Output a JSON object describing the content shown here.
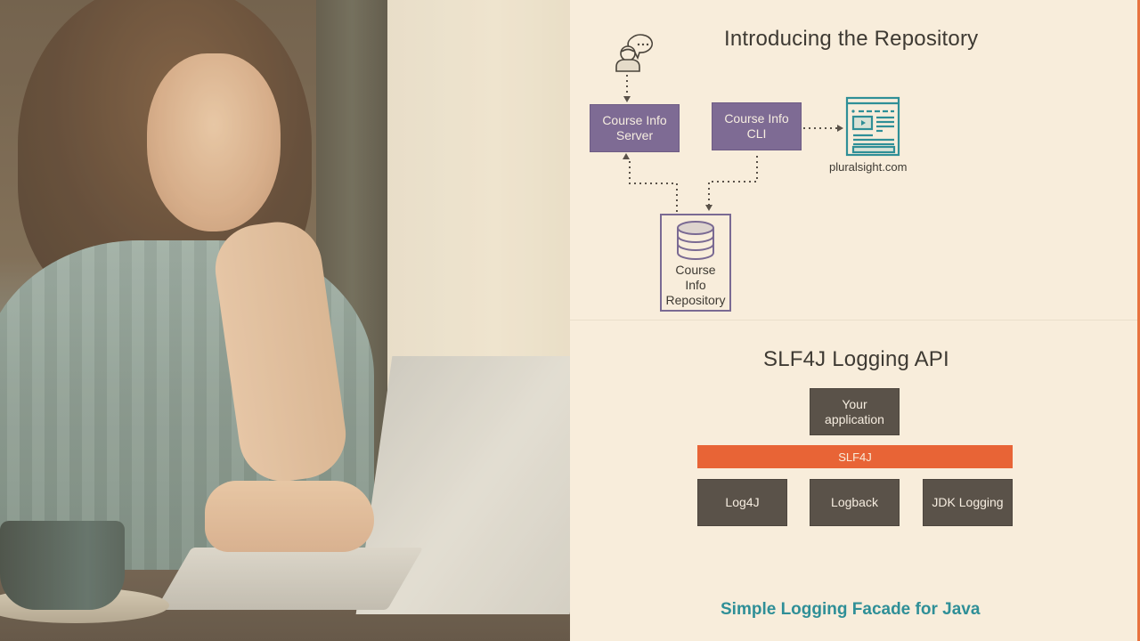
{
  "photo": {
    "description": "Woman in grey-blue cable-knit sweater typing on a laptop beside a coffee cup"
  },
  "slide": {
    "accent_color": "#e8733f",
    "repository_section": {
      "title": "Introducing the Repository",
      "user_icon": "user-chat-icon",
      "website_icon": "website-icon",
      "database_icon": "database-icon",
      "boxes": {
        "server": {
          "line1": "Course Info",
          "line2": "Server"
        },
        "cli": {
          "line1": "Course Info",
          "line2": "CLI"
        },
        "repository": {
          "line1": "Course",
          "line2": "Info",
          "line3": "Repository"
        }
      },
      "website_label": "pluralsight.com",
      "colors": {
        "box_fill": "#7e6b94",
        "icon_teal": "#2f8f97",
        "arrow": "#5a5249"
      }
    },
    "slf4j_section": {
      "title": "SLF4J Logging API",
      "app_box": {
        "line1": "Your",
        "line2": "application"
      },
      "facade_bar": "SLF4J",
      "implementations": [
        "Log4J",
        "Logback",
        "JDK Logging"
      ],
      "subtitle": "Simple Logging Facade for Java",
      "colors": {
        "box_fill": "#5a5249",
        "bar_fill": "#e86436",
        "subtitle": "#2f8f97"
      }
    }
  }
}
